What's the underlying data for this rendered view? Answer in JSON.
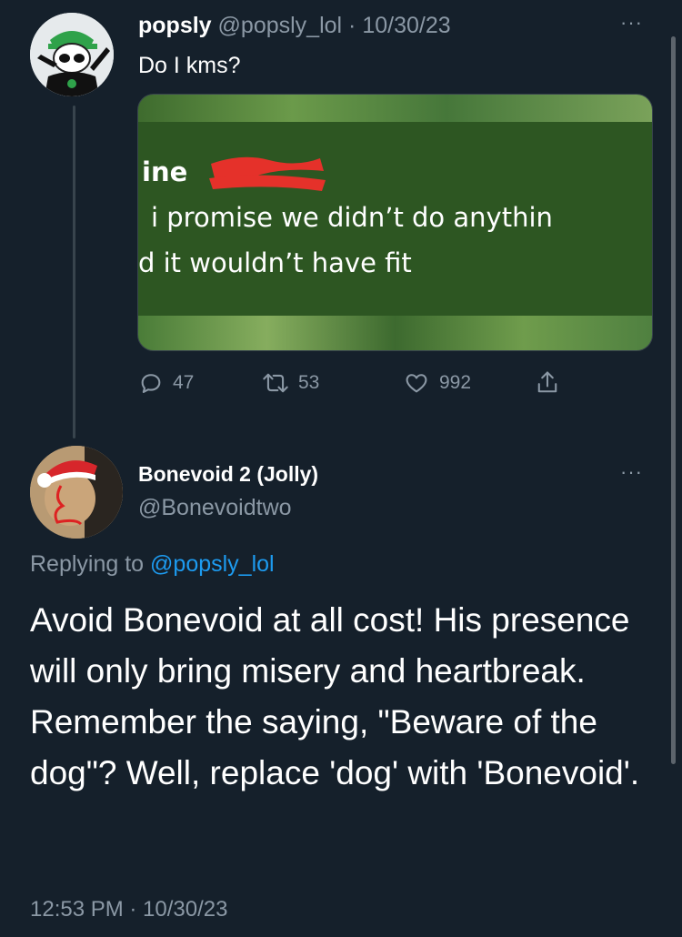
{
  "tweet1": {
    "display_name": "popsly",
    "handle": "@popsly_lol",
    "separator": "·",
    "date": "10/30/23",
    "text": "Do I kms?",
    "more": "···",
    "media_text": {
      "line1": "ine",
      "line2": "i promise we didn’t do anythin",
      "line3": "d it wouldn’t have fit"
    },
    "actions": {
      "replies": "47",
      "retweets": "53",
      "likes": "992"
    }
  },
  "tweet2": {
    "display_name": "Bonevoid 2 (Jolly)",
    "handle": "@Bonevoidtwo",
    "more": "···",
    "replying_prefix": "Replying to",
    "replying_handle": "@popsly_lol",
    "body": "Avoid Bonevoid at all cost! His presence will only bring misery and heartbreak. Remember the saying, \"Beware of the dog\"? Well, replace 'dog' with 'Bonevoid'.",
    "timestamp": "12:53 PM · 10/30/23"
  },
  "colors": {
    "background": "#15202b",
    "text": "#ffffff",
    "muted": "#8b98a5",
    "link": "#1d9bf0",
    "media_green": "#2f5a26",
    "redaction_red": "#e5312a"
  }
}
